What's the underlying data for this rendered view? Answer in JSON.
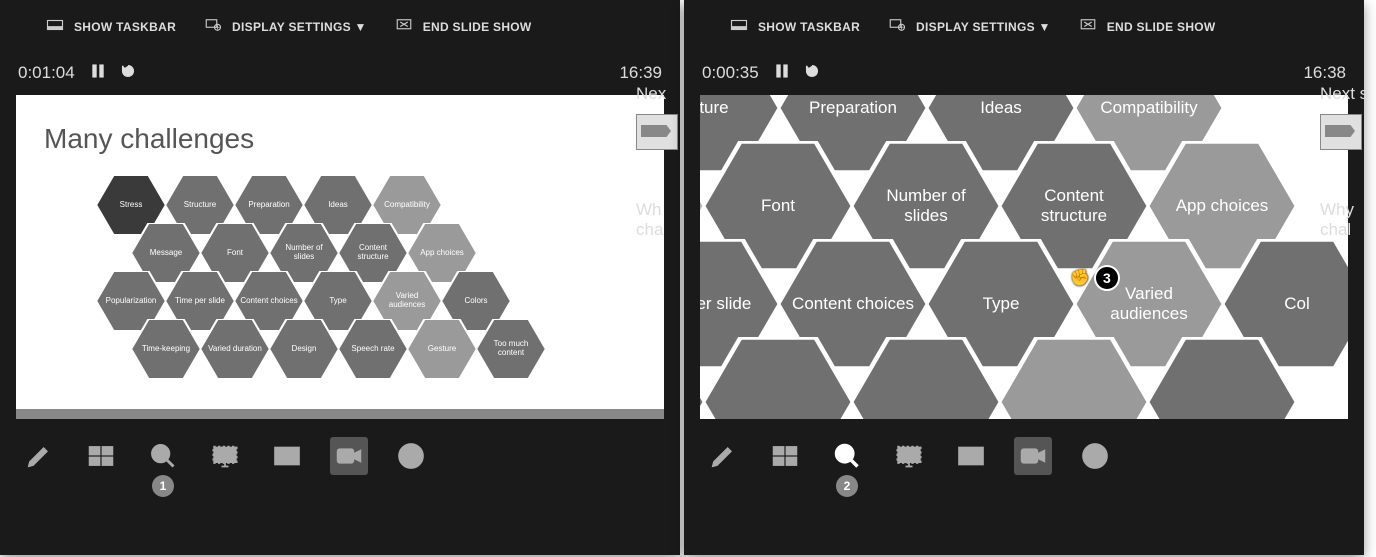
{
  "toolbar": {
    "show_taskbar": "SHOW TASKBAR",
    "display_settings": "DISPLAY SETTINGS ▼",
    "end_show": "END SLIDE SHOW"
  },
  "left_panel": {
    "elapsed": "0:01:04",
    "clock": "16:39",
    "slide_title": "Many challenges",
    "hex_rows": [
      [
        "Stress",
        "Structure",
        "Preparation",
        "Ideas",
        "Compatibility"
      ],
      [
        "Message",
        "Font",
        "Number of slides",
        "Content structure",
        "App choices"
      ],
      [
        "Popularization",
        "Time per slide",
        "Content choices",
        "Type",
        "Varied audiences",
        "Colors"
      ],
      [
        "Time-keeping",
        "Varied duration",
        "Design",
        "Speech rate",
        "Gesture",
        "Too much content"
      ]
    ],
    "hex_shades": [
      [
        "d",
        "m",
        "m",
        "m",
        "l"
      ],
      [
        "m",
        "m",
        "m",
        "m",
        "l"
      ],
      [
        "m",
        "m",
        "m",
        "m",
        "l",
        "m"
      ],
      [
        "m",
        "m",
        "m",
        "m",
        "l",
        "m"
      ]
    ],
    "next_label": "Nex",
    "next_title_1": "Wh",
    "next_title_2": "cha",
    "tool_badge": "1"
  },
  "right_panel": {
    "elapsed": "0:00:35",
    "clock": "16:38",
    "big_rows": [
      [
        {
          "t": "ucture",
          "s": "m"
        },
        {
          "t": "Preparation",
          "s": "m"
        },
        {
          "t": "Ideas",
          "s": "m"
        },
        {
          "t": "Compatibility",
          "s": "l"
        }
      ],
      [
        {
          "t": "",
          "s": "n"
        },
        {
          "t": "Font",
          "s": "m"
        },
        {
          "t": "Number of slides",
          "s": "m"
        },
        {
          "t": "Content structure",
          "s": "m"
        },
        {
          "t": "App choices",
          "s": "l"
        }
      ],
      [
        {
          "t": "me per slide",
          "s": "m"
        },
        {
          "t": "Content choices",
          "s": "m"
        },
        {
          "t": "Type",
          "s": "m"
        },
        {
          "t": "Varied audiences",
          "s": "l"
        },
        {
          "t": "Col",
          "s": "m"
        }
      ],
      [
        {
          "t": "",
          "s": "m"
        },
        {
          "t": "",
          "s": "m"
        },
        {
          "t": "",
          "s": "m"
        },
        {
          "t": "",
          "s": "l"
        },
        {
          "t": "",
          "s": "m"
        }
      ]
    ],
    "cursor_badge": "3",
    "next_label": "Next s",
    "next_title_1": "Why",
    "next_title_2": "chal",
    "tool_badge": "2"
  },
  "colors": {
    "d": "#3a3a3a",
    "m": "#707070",
    "l": "#9a9a9a",
    "n": "#b8b8b8"
  }
}
